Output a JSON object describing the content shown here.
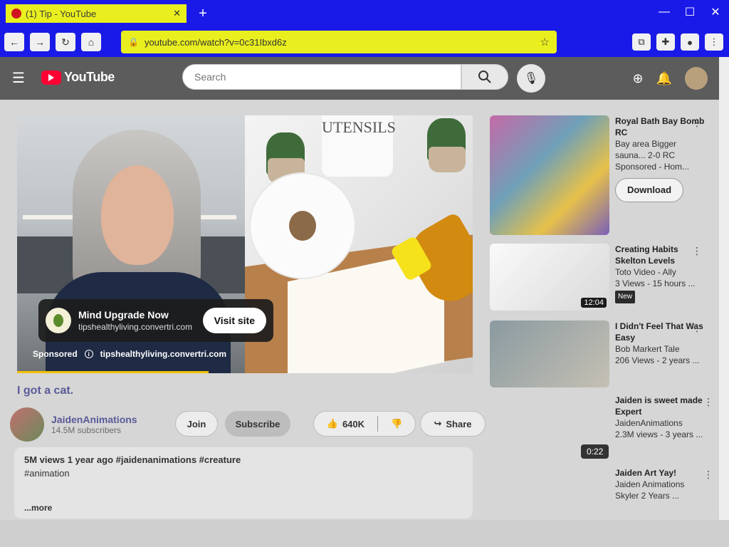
{
  "browser": {
    "tab_title": "(1) Tip - YouTube",
    "url": "youtube.com/watch?v=0c31Ibxd6z",
    "icons": {
      "back": "arrow-left-icon",
      "forward": "arrow-right-icon",
      "reload": "reload-icon",
      "star": "star-icon"
    }
  },
  "masthead": {
    "logo_text": "YouTube",
    "search_placeholder": "Search"
  },
  "player": {
    "ad": {
      "title": "Mind Upgrade Now",
      "domain": "tipshealthyliving.convertri.com",
      "cta": "Visit site",
      "sponsored": "Sponsored",
      "footer_domain": "tipshealthyliving.convertri.com"
    },
    "jar_label": "UTENSILS",
    "progress": 0.42
  },
  "video": {
    "title": "I got a cat.",
    "channel": "JaidenAnimations",
    "subs": "14.5M subscribers",
    "join": "Join",
    "subscribe": "Subscribe",
    "likes": "640K",
    "share": "Share",
    "desc_stats": "5M views  1 year ago  #jaidenanimations #creature",
    "desc_line2": "#animation",
    "desc_more": "...more"
  },
  "sidebar": {
    "items": [
      {
        "title": "Royal Bath Bay Bomb RC",
        "meta": "Bay area Bigger sauna... 2-0 RC",
        "sub": "Sponsored - Hom...",
        "button": "Download"
      },
      {
        "title": "Creating Habits Skelton Levels",
        "meta": "Toto Video - Ally",
        "sub": "3 Views - 15 hours ...",
        "badge": "New",
        "duration": "12:04"
      },
      {
        "title": "I Didn't Feel That Was Easy",
        "meta": "Bob Markert Tale",
        "sub": "206 Views - 2 years ..."
      },
      {
        "title": "Jaiden is sweet made Expert",
        "meta": "JaidenAnimations",
        "sub": "2.3M views - 3 years ..."
      },
      {
        "title": "Jaiden Art Yay!",
        "meta": "Jaiden Animations",
        "sub": "Skyler 2 Years ..."
      }
    ],
    "chip": "0:22"
  }
}
